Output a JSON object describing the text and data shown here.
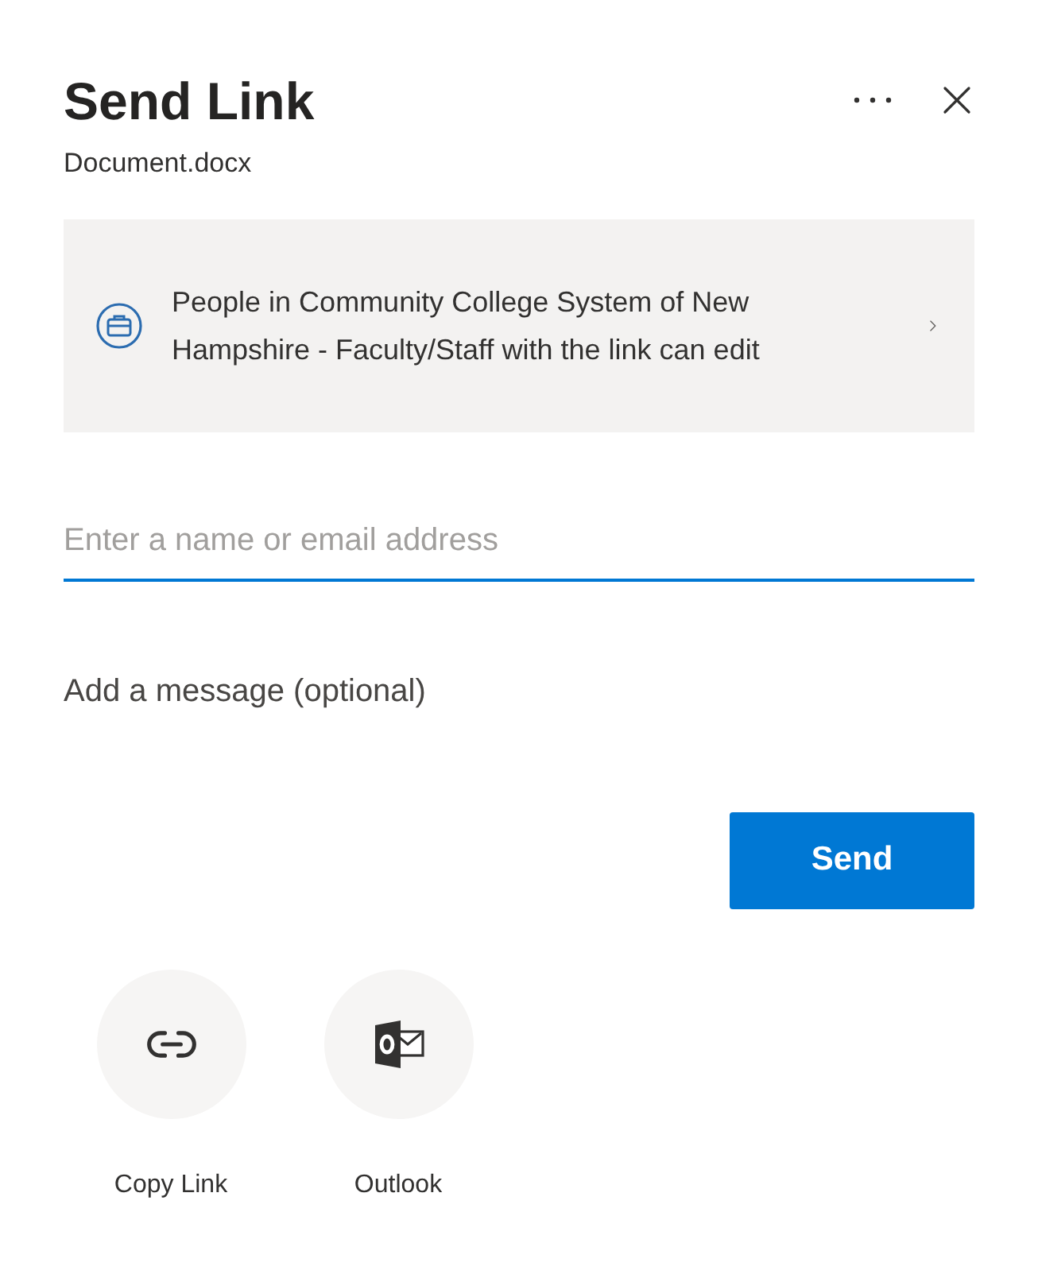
{
  "header": {
    "title": "Send Link",
    "file_name": "Document.docx"
  },
  "link_settings": {
    "text": "People in Community College System of New Hampshire - Faculty/Staff with the link can edit"
  },
  "recipient_field": {
    "placeholder": "Enter a name or email address"
  },
  "message_field": {
    "placeholder": "Add a message (optional)"
  },
  "send_button": {
    "label": "Send"
  },
  "share_options": [
    {
      "kind": "copy",
      "label": "Copy Link"
    },
    {
      "kind": "outlook",
      "label": "Outlook"
    }
  ]
}
